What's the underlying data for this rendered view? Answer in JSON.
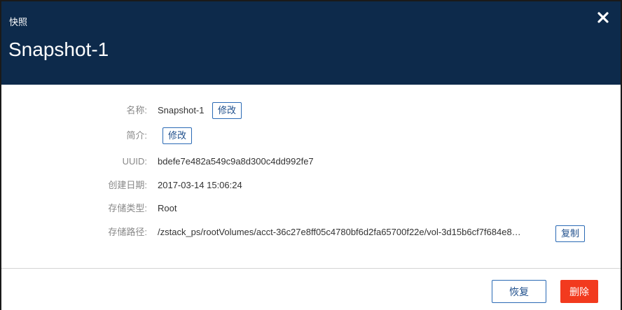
{
  "header": {
    "subtitle": "快照",
    "title": "Snapshot-1",
    "close_icon": "close-icon"
  },
  "details": {
    "name": {
      "label": "名称:",
      "value": "Snapshot-1",
      "edit_label": "修改"
    },
    "description": {
      "label": "简介:",
      "edit_label": "修改"
    },
    "uuid": {
      "label": "UUID:",
      "value": "bdefe7e482a549c9a8d300c4dd992fe7"
    },
    "created": {
      "label": "创建日期:",
      "value": "2017-03-14 15:06:24"
    },
    "storage_type": {
      "label": "存储类型:",
      "value": "Root"
    },
    "storage_path": {
      "label": "存储路径:",
      "value": "/zstack_ps/rootVolumes/acct-36c27e8ff05c4780bf6d2fa65700f22e/vol-3d15b6cf7f684e8…",
      "copy_label": "复制"
    }
  },
  "footer": {
    "restore_label": "恢复",
    "delete_label": "删除"
  },
  "colors": {
    "header_bg": "#0d2a4b",
    "accent": "#2a6ab5",
    "danger": "#f23a1e"
  }
}
